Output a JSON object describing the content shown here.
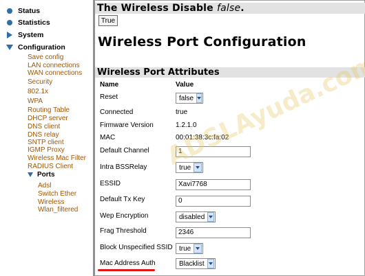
{
  "sidebar": {
    "top_items": [
      {
        "label": "Status",
        "icon": "bullet-icon"
      },
      {
        "label": "Statistics",
        "icon": "bullet-icon"
      },
      {
        "label": "System",
        "icon": "triangle-right-icon"
      },
      {
        "label": "Configuration",
        "icon": "triangle-down-icon"
      }
    ],
    "config_items": [
      "Save config",
      "LAN connections",
      "WAN connections",
      "Security",
      "802.1x",
      "WPA",
      "Routing Table",
      "DHCP server",
      "DNS client",
      "DNS relay",
      "SNTP client",
      "IGMP Proxy",
      "Wireless Mac Filter",
      "RADIUS Client"
    ],
    "ports_label": "Ports",
    "port_items": [
      "Adsl",
      "Switch Ether",
      "Wireless",
      "Wlan_filtered"
    ]
  },
  "header": {
    "disable_prefix": "The Wireless Disable ",
    "disable_value": "false",
    "disable_suffix": ".",
    "true_button": "True"
  },
  "page_title": "Wireless Port Configuration",
  "attributes": {
    "section_title": "Wireless Port Attributes",
    "col_name": "Name",
    "col_value": "Value",
    "rows": {
      "reset": {
        "label": "Reset",
        "value": "false"
      },
      "connected": {
        "label": "Connected",
        "value": "true"
      },
      "firmware": {
        "label": "Firmware Version",
        "value": "1.2.1.0"
      },
      "mac": {
        "label": "MAC",
        "value": "00:01:38:3c:fa:02"
      },
      "default_channel": {
        "label": "Default Channel",
        "value": "1"
      },
      "intra_bss": {
        "label": "Intra BSSRelay",
        "value": "true"
      },
      "essid": {
        "label": "ESSID",
        "value": "Xavi7768"
      },
      "default_tx_key": {
        "label": "Default Tx Key",
        "value": "0"
      },
      "wep": {
        "label": "Wep Encryption",
        "value": "disabled"
      },
      "frag": {
        "label": "Frag Threshold",
        "value": "2346"
      },
      "block_ssid": {
        "label": "Block Unspecified SSID",
        "value": "true"
      },
      "mac_auth": {
        "label": "Mac Address Auth",
        "value": "Blacklist"
      }
    }
  },
  "watermark": "ADSLAyuda.com",
  "colors": {
    "nav_icon": "#2f6fa8",
    "sub_link": "#a15500",
    "header_bar": "#e2e2e2",
    "highlight": "#e31414"
  }
}
